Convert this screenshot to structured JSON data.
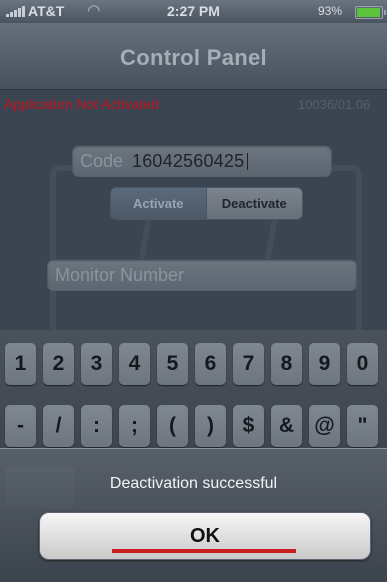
{
  "status_bar": {
    "carrier": "AT&T",
    "time": "2:27 PM",
    "battery": "93%"
  },
  "nav": {
    "title": "Control Panel"
  },
  "main": {
    "activation_status": "Application Not Activated",
    "version": "10036/01.06",
    "code_field": {
      "label": "Code",
      "value": "16042560425"
    },
    "segments": {
      "activate": "Activate",
      "deactivate": "Deactivate",
      "selected": "Deactivate"
    },
    "monitor_field": {
      "placeholder": "Monitor Number"
    }
  },
  "keyboard": {
    "row1": [
      "1",
      "2",
      "3",
      "4",
      "5",
      "6",
      "7",
      "8",
      "9",
      "0"
    ],
    "row2": [
      "-",
      "/",
      ":",
      ";",
      "(",
      ")",
      "$",
      "&",
      "@",
      "\""
    ]
  },
  "alert": {
    "message": "Deactivation successful",
    "button": "OK"
  },
  "colors": {
    "error_text": "#c2141d",
    "battery": "#5cc43a",
    "annotation_underline": "#c8201f"
  }
}
